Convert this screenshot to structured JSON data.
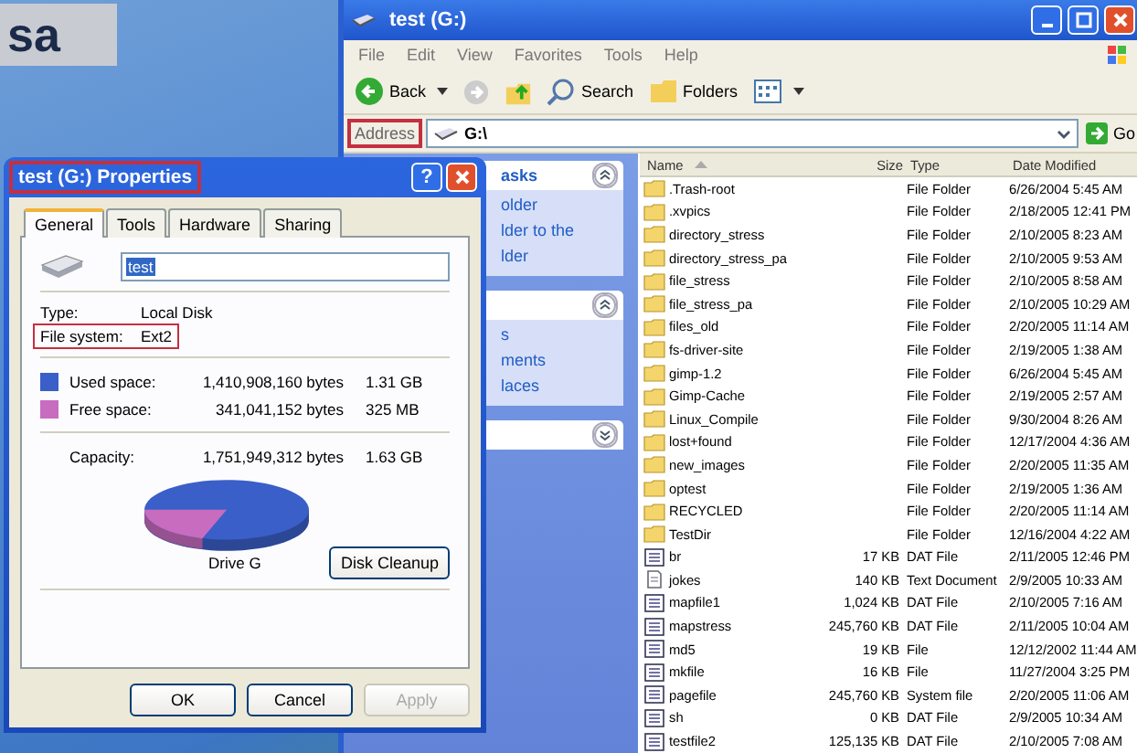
{
  "page_fragment": "sa",
  "explorer": {
    "title": "test (G:)",
    "menu": [
      "File",
      "Edit",
      "View",
      "Favorites",
      "Tools",
      "Help"
    ],
    "toolbar": {
      "back": "Back",
      "search": "Search",
      "folders": "Folders"
    },
    "address": {
      "label": "Address",
      "value": "G:\\",
      "go": "Go",
      "highlighted": true
    },
    "task_pane": {
      "sections": [
        {
          "title": "asks",
          "expanded": true,
          "lines": [
            "older",
            "lder to the",
            "lder"
          ]
        },
        {
          "expanded": true,
          "lines": [
            "s",
            "ments",
            "laces"
          ]
        },
        {
          "expanded": false
        }
      ]
    },
    "columns": [
      {
        "label": "Name",
        "sorted": true
      },
      {
        "label": "Size",
        "sorted": false
      },
      {
        "label": "Type",
        "sorted": false
      },
      {
        "label": "Date Modified",
        "sorted": false
      }
    ],
    "files": [
      {
        "kind": "folder",
        "name": ".Trash-root",
        "type": "File Folder",
        "date": "6/26/2004 5:45 AM"
      },
      {
        "kind": "folder",
        "name": ".xvpics",
        "type": "File Folder",
        "date": "2/18/2005 12:41 PM"
      },
      {
        "kind": "folder",
        "name": "directory_stress",
        "type": "File Folder",
        "date": "2/10/2005 8:23 AM"
      },
      {
        "kind": "folder",
        "name": "directory_stress_pa",
        "type": "File Folder",
        "date": "2/10/2005 9:53 AM"
      },
      {
        "kind": "folder",
        "name": "file_stress",
        "type": "File Folder",
        "date": "2/10/2005 8:58 AM"
      },
      {
        "kind": "folder",
        "name": "file_stress_pa",
        "type": "File Folder",
        "date": "2/10/2005 10:29 AM"
      },
      {
        "kind": "folder",
        "name": "files_old",
        "type": "File Folder",
        "date": "2/20/2005 11:14 AM"
      },
      {
        "kind": "folder",
        "name": "fs-driver-site",
        "type": "File Folder",
        "date": "2/19/2005 1:38 AM"
      },
      {
        "kind": "folder",
        "name": "gimp-1.2",
        "type": "File Folder",
        "date": "6/26/2004 5:45 AM"
      },
      {
        "kind": "folder",
        "name": "Gimp-Cache",
        "type": "File Folder",
        "date": "2/19/2005 2:57 AM"
      },
      {
        "kind": "folder",
        "name": "Linux_Compile",
        "type": "File Folder",
        "date": "9/30/2004 8:26 AM"
      },
      {
        "kind": "folder",
        "name": "lost+found",
        "type": "File Folder",
        "date": "12/17/2004 4:36 AM"
      },
      {
        "kind": "folder",
        "name": "new_images",
        "type": "File Folder",
        "date": "2/20/2005 11:35 AM"
      },
      {
        "kind": "folder",
        "name": "optest",
        "type": "File Folder",
        "date": "2/19/2005 1:36 AM"
      },
      {
        "kind": "folder",
        "name": "RECYCLED",
        "type": "File Folder",
        "date": "2/20/2005 11:14 AM"
      },
      {
        "kind": "folder",
        "name": "TestDir",
        "type": "File Folder",
        "date": "12/16/2004 4:22 AM"
      },
      {
        "kind": "data",
        "name": "br",
        "size": "17 KB",
        "type": "DAT File",
        "date": "2/11/2005 12:46 PM"
      },
      {
        "kind": "text",
        "name": "jokes",
        "size": "140 KB",
        "type": "Text Document",
        "date": "2/9/2005 10:33 AM"
      },
      {
        "kind": "data",
        "name": "mapfile1",
        "size": "1,024 KB",
        "type": "DAT File",
        "date": "2/10/2005 7:16 AM"
      },
      {
        "kind": "data",
        "name": "mapstress",
        "size": "245,760 KB",
        "type": "DAT File",
        "date": "2/11/2005 10:04 AM"
      },
      {
        "kind": "data",
        "name": "md5",
        "size": "19 KB",
        "type": "File",
        "date": "12/12/2002 11:44 AM"
      },
      {
        "kind": "data",
        "name": "mkfile",
        "size": "16 KB",
        "type": "File",
        "date": "11/27/2004 3:25 PM"
      },
      {
        "kind": "data",
        "name": "pagefile",
        "size": "245,760 KB",
        "type": "System file",
        "date": "2/20/2005 11:06 AM"
      },
      {
        "kind": "data",
        "name": "sh",
        "size": "0 KB",
        "type": "DAT File",
        "date": "2/9/2005 10:34 AM"
      },
      {
        "kind": "data",
        "name": "testfile2",
        "size": "125,135 KB",
        "type": "DAT File",
        "date": "2/10/2005 7:08 AM"
      }
    ]
  },
  "dialog": {
    "title": "test (G:) Properties",
    "title_highlighted": true,
    "help": "?",
    "tabs": [
      {
        "label": "General",
        "selected": true
      },
      {
        "label": "Tools",
        "selected": false
      },
      {
        "label": "Hardware",
        "selected": false
      },
      {
        "label": "Sharing",
        "selected": false
      }
    ],
    "name_value": "test",
    "info": [
      {
        "label": "Type:",
        "value": "Local Disk",
        "highlighted": false
      },
      {
        "label": "File system:",
        "value": "Ext2",
        "highlighted": true
      }
    ],
    "space": [
      {
        "label": "Used space:",
        "bytes": "1,410,908,160 bytes",
        "size": "1.31 GB",
        "color": "#3a5fc8"
      },
      {
        "label": "Free space:",
        "bytes": "341,041,152 bytes",
        "size": "325 MB",
        "color": "#c86cc0"
      }
    ],
    "capacity": {
      "label": "Capacity:",
      "bytes": "1,751,949,312 bytes",
      "size": "1.63 GB"
    },
    "drive_label": "Drive G",
    "cleanup": "Disk Cleanup",
    "buttons": [
      {
        "label": "OK",
        "disabled": false
      },
      {
        "label": "Cancel",
        "disabled": false
      },
      {
        "label": "Apply",
        "disabled": true
      }
    ]
  }
}
